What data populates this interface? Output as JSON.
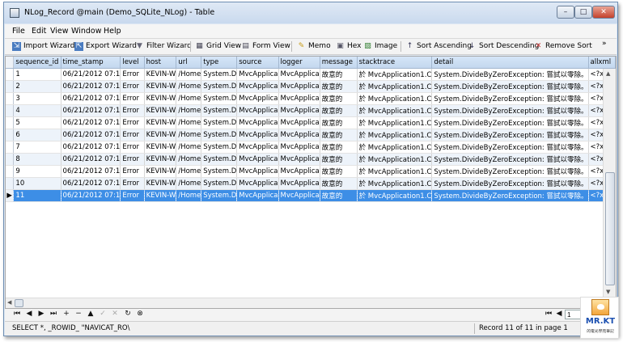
{
  "window": {
    "title": "NLog_Record @main (Demo_SQLite_NLog) - Table",
    "buttons": {
      "minimize": "–",
      "maximize": "□",
      "close": "✕"
    }
  },
  "menu": [
    "File",
    "Edit",
    "View",
    "Window",
    "Help"
  ],
  "toolbar": {
    "import_wizard": "Import Wizard",
    "export_wizard": "Export Wizard",
    "filter_wizard": "Filter Wizard",
    "grid_view": "Grid View",
    "form_view": "Form View",
    "memo": "Memo",
    "hex": "Hex",
    "image": "Image",
    "sort_ascending": "Sort Ascending",
    "sort_descending": "Sort Descending",
    "remove_sort": "Remove Sort",
    "more": "»"
  },
  "table": {
    "columns": [
      "sequence_id",
      "time_stamp",
      "level",
      "host",
      "url",
      "type",
      "source",
      "logger",
      "message",
      "stacktrace",
      "detail",
      "allxml"
    ],
    "rows": [
      [
        "1",
        "06/21/2012 07:1",
        "Error",
        "KEVIN-W",
        "/Home",
        "System.D",
        "MvcApplica",
        "MvcApplica",
        "故意的",
        "於 MvcApplication1.C",
        "System.DivideByZeroException: 嘗試以零除。",
        "<?xml"
      ],
      [
        "2",
        "06/21/2012 07:1",
        "Error",
        "KEVIN-W",
        "/Home",
        "System.D",
        "MvcApplica",
        "MvcApplica",
        "故意的",
        "於 MvcApplication1.C",
        "System.DivideByZeroException: 嘗試以零除。",
        "<?xml"
      ],
      [
        "3",
        "06/21/2012 07:1",
        "Error",
        "KEVIN-W",
        "/Home",
        "System.D",
        "MvcApplica",
        "MvcApplica",
        "故意的",
        "於 MvcApplication1.C",
        "System.DivideByZeroException: 嘗試以零除。",
        "<?xml"
      ],
      [
        "4",
        "06/21/2012 07:1",
        "Error",
        "KEVIN-W",
        "/Home",
        "System.D",
        "MvcApplica",
        "MvcApplica",
        "故意的",
        "於 MvcApplication1.C",
        "System.DivideByZeroException: 嘗試以零除。",
        "<?xml"
      ],
      [
        "5",
        "06/21/2012 07:1",
        "Error",
        "KEVIN-W",
        "/Home",
        "System.D",
        "MvcApplica",
        "MvcApplica",
        "故意的",
        "於 MvcApplication1.C",
        "System.DivideByZeroException: 嘗試以零除。",
        "<?xml"
      ],
      [
        "6",
        "06/21/2012 07:1",
        "Error",
        "KEVIN-W",
        "/Home",
        "System.D",
        "MvcApplica",
        "MvcApplica",
        "故意的",
        "於 MvcApplication1.C",
        "System.DivideByZeroException: 嘗試以零除。",
        "<?xml"
      ],
      [
        "7",
        "06/21/2012 07:1",
        "Error",
        "KEVIN-W",
        "/Home",
        "System.D",
        "MvcApplica",
        "MvcApplica",
        "故意的",
        "於 MvcApplication1.C",
        "System.DivideByZeroException: 嘗試以零除。",
        "<?xml"
      ],
      [
        "8",
        "06/21/2012 07:1",
        "Error",
        "KEVIN-W",
        "/Home",
        "System.D",
        "MvcApplica",
        "MvcApplica",
        "故意的",
        "於 MvcApplication1.C",
        "System.DivideByZeroException: 嘗試以零除。",
        "<?xml"
      ],
      [
        "9",
        "06/21/2012 07:1",
        "Error",
        "KEVIN-W",
        "/Home",
        "System.D",
        "MvcApplica",
        "MvcApplica",
        "故意的",
        "於 MvcApplication1.C",
        "System.DivideByZeroException: 嘗試以零除。",
        "<?xml"
      ],
      [
        "10",
        "06/21/2012 07:1",
        "Error",
        "KEVIN-W",
        "/Home",
        "System.D",
        "MvcApplica",
        "MvcApplica",
        "故意的",
        "於 MvcApplication1.C",
        "System.DivideByZeroException: 嘗試以零除。",
        "<?xml"
      ],
      [
        "11",
        "06/21/2012 07:1",
        "Error",
        "KEVIN-W",
        "/Home",
        "System.D",
        "MvcApplica",
        "MvcApplica",
        "故意的",
        "於 MvcApplication1.C",
        "System.DivideByZeroException: 嘗試以零除。",
        "<?xml"
      ]
    ],
    "selected_row": 11,
    "row_indicator": "▶"
  },
  "navigator": {
    "page_value": "1",
    "icons": [
      "first-record",
      "prev-record",
      "next-record",
      "last-record",
      "add-record",
      "delete-record",
      "post-edit",
      "cancel-edit",
      "clear",
      "refresh",
      "stop"
    ]
  },
  "status": {
    "sql": "SELECT *, _ROWID_ \"NAVICAT_RO\\",
    "record": "Record 11 of 11 in page 1"
  },
  "watermark": {
    "title": "MR.KT",
    "subtitle": "的電光學苑筆記"
  },
  "colors": {
    "selection": "#3d8ee6",
    "header": "#c3d7ee",
    "alt_row": "#edf3fa"
  }
}
